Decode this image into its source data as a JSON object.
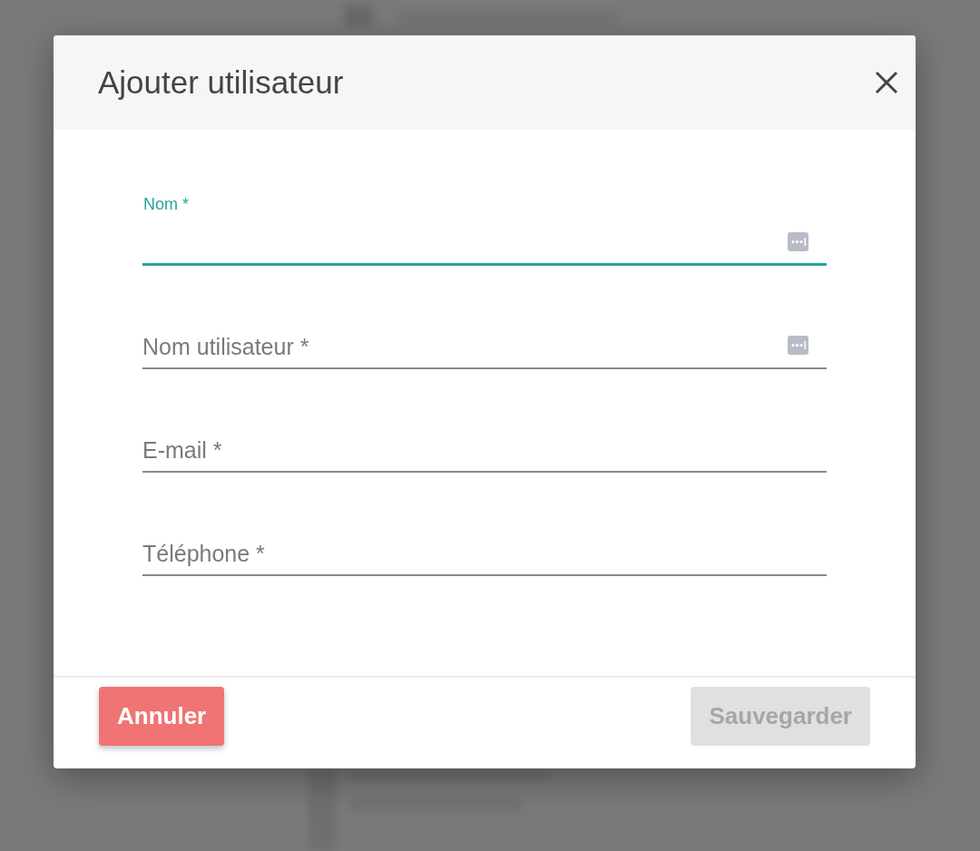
{
  "dialog": {
    "title": "Ajouter utilisateur",
    "fields": [
      {
        "label": "Nom *",
        "focused": true,
        "autofill_icon": true
      },
      {
        "placeholder": "Nom utilisateur *",
        "focused": false,
        "autofill_icon": true
      },
      {
        "placeholder": "E-mail *",
        "focused": false,
        "autofill_icon": false
      },
      {
        "placeholder": "Téléphone *",
        "focused": false,
        "autofill_icon": false
      }
    ],
    "buttons": [
      {
        "label": "Annuler",
        "kind": "cancel",
        "disabled": false
      },
      {
        "label": "Sauvegarder",
        "kind": "save",
        "disabled": true
      }
    ]
  }
}
